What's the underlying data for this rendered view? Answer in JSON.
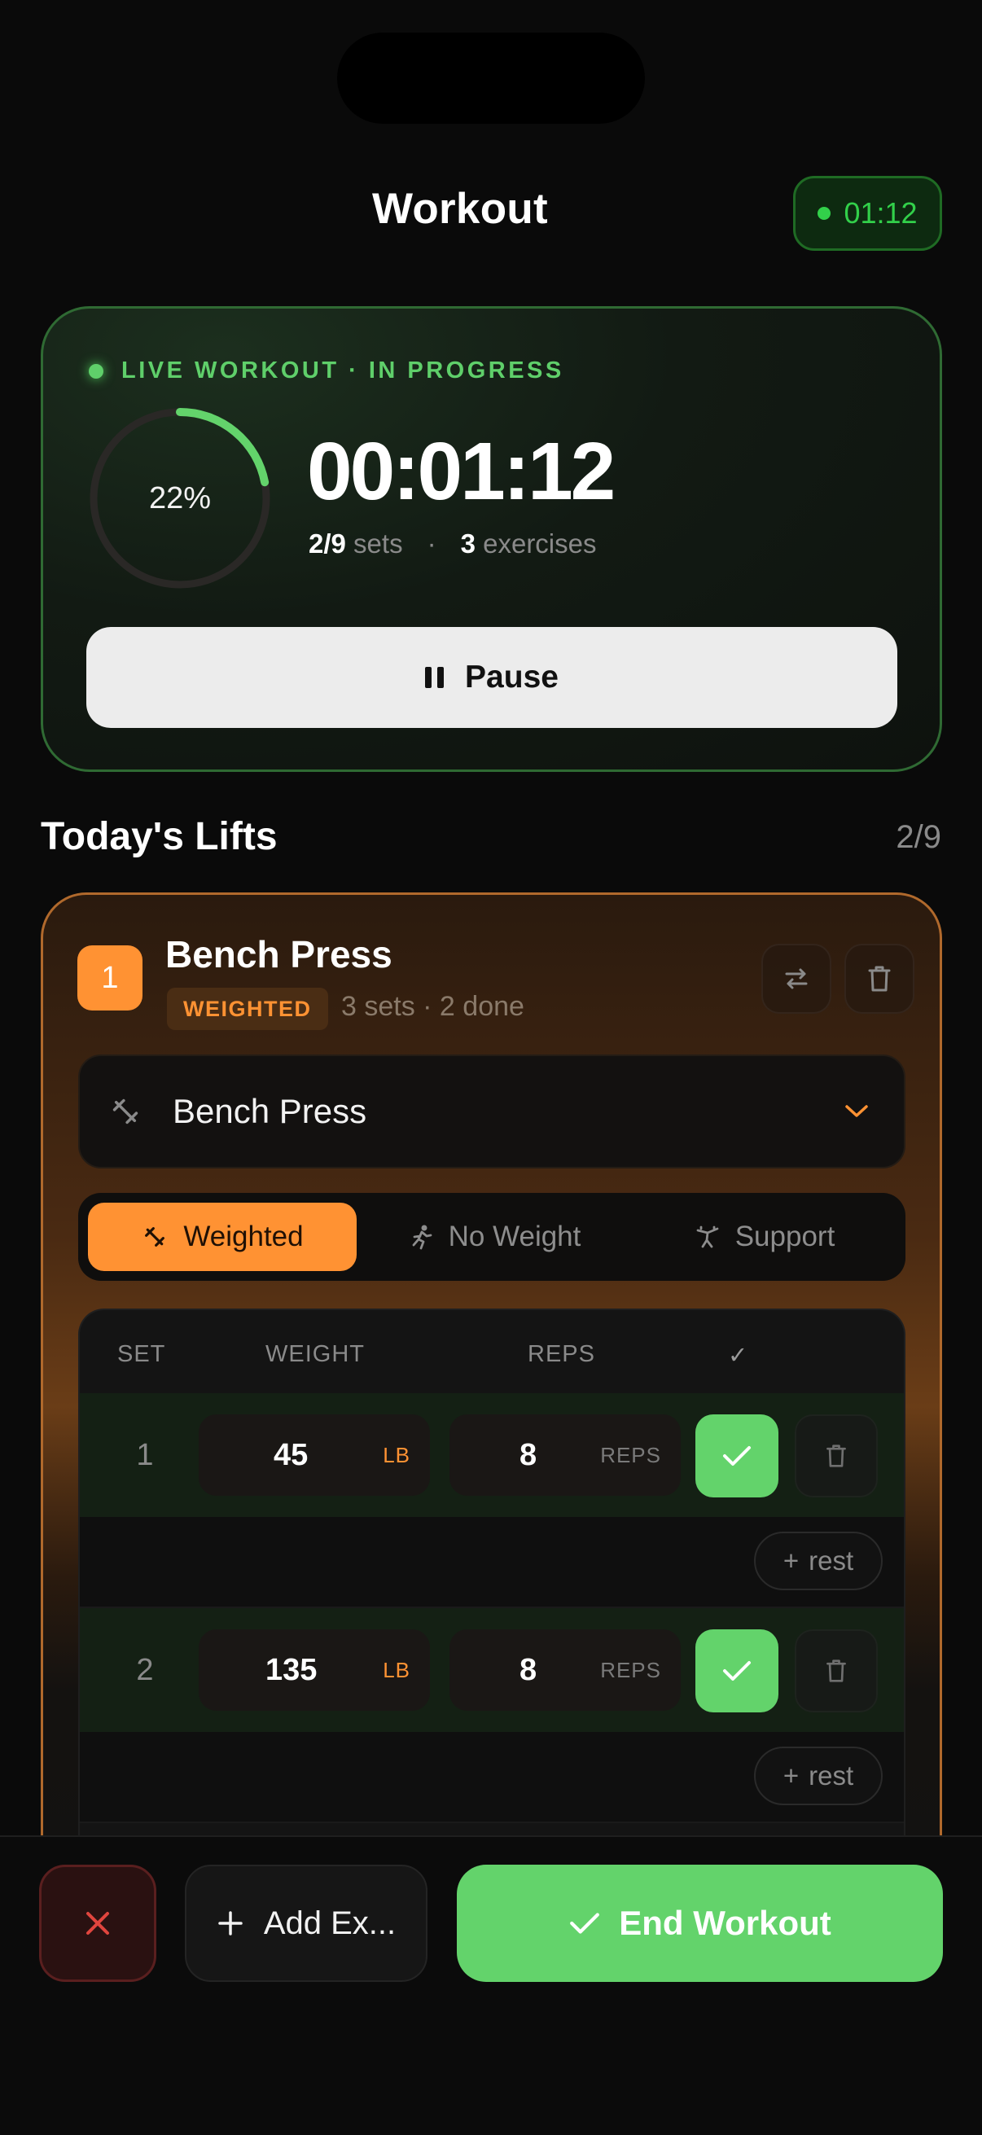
{
  "header": {
    "title": "Workout",
    "timer": "01:12"
  },
  "live": {
    "label": "LIVE WORKOUT · IN PROGRESS",
    "progress_text": "22%",
    "progress": 0.22,
    "elapsed": "00:01:12",
    "sets_value": "2/9",
    "sets_label": "sets",
    "separator": "·",
    "exercises_value": "3",
    "exercises_label": "exercises",
    "pause_label": "Pause"
  },
  "section": {
    "title": "Today's Lifts",
    "count": "2/9"
  },
  "exercise": {
    "number": "1",
    "name": "Bench Press",
    "badge": "WEIGHTED",
    "meta": "3 sets · 2 done",
    "selected": "Bench Press",
    "types": [
      {
        "label": "Weighted",
        "icon": "barbell-icon",
        "active": true
      },
      {
        "label": "No Weight",
        "icon": "running-person-icon",
        "active": false
      },
      {
        "label": "Support",
        "icon": "assisted-icon",
        "active": false
      }
    ],
    "columns": {
      "set": "SET",
      "weight": "WEIGHT",
      "reps": "REPS",
      "done": "✓"
    },
    "sets": [
      {
        "set": "1",
        "weight": "45",
        "weight_unit": "LB",
        "reps": "8",
        "reps_unit": "REPS",
        "done": true
      },
      {
        "set": "2",
        "weight": "135",
        "weight_unit": "LB",
        "reps": "8",
        "reps_unit": "REPS",
        "done": true
      }
    ],
    "rest_label": "rest",
    "rest_plus": "+"
  },
  "bottom": {
    "add_label": "Add Ex...",
    "end_label": "End Workout"
  },
  "colors": {
    "accent_orange": "#ff9233",
    "accent_green": "#63d36b",
    "live_green": "#5fcf6a",
    "danger_red": "#e0453e"
  }
}
